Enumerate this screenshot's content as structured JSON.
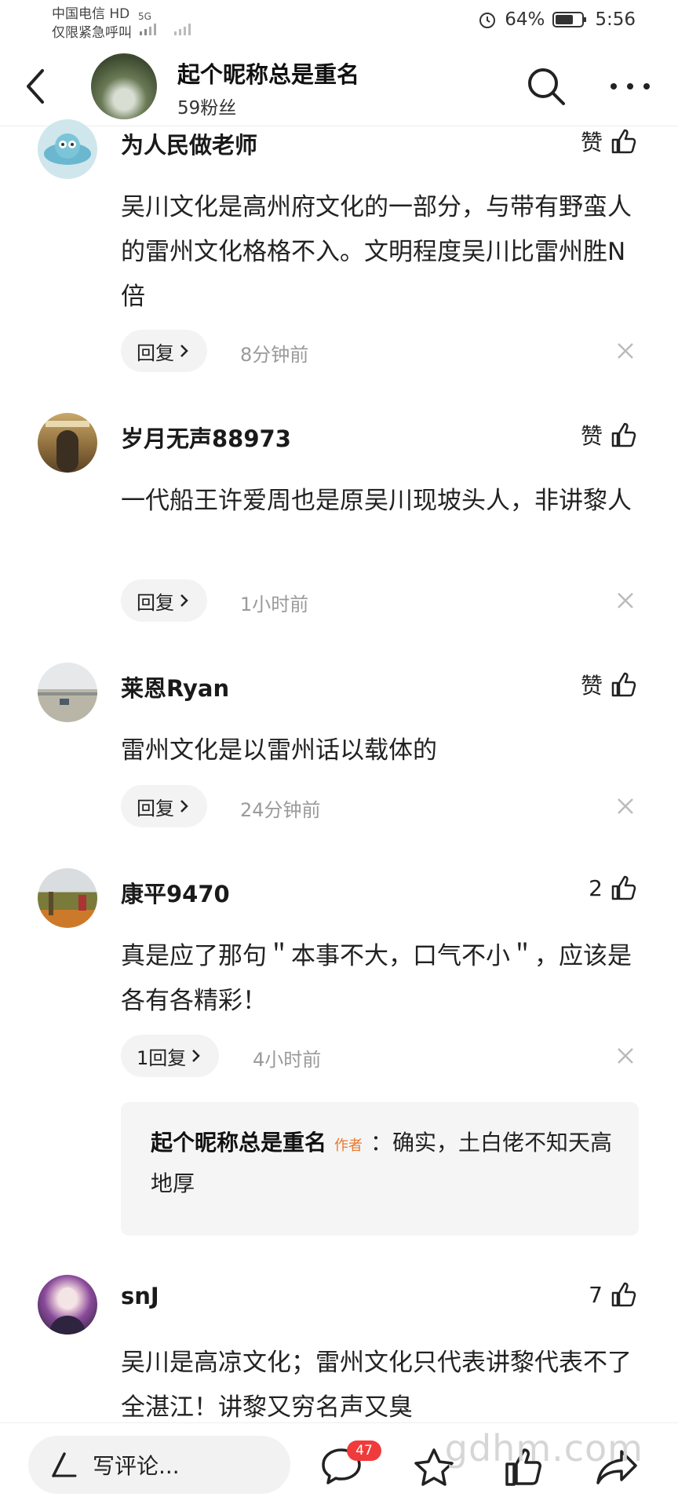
{
  "status_bar": {
    "carrier_line1": "中国电信 HD",
    "carrier_line2": "仅限紧急呼叫",
    "signal": "5G",
    "battery": "64%",
    "time": "5:56"
  },
  "header": {
    "name": "起个昵称总是重名",
    "fans": "59粉丝"
  },
  "comments": [
    {
      "user": "为人民做老师",
      "like": "赞",
      "text": "吴川文化是高州府文化的一部分，与带有野蛮人的雷州文化格格不入。文明程度吴川比雷州胜N倍",
      "reply": "回复",
      "time": "8分钟前"
    },
    {
      "user": "岁月无声88973",
      "like": "赞",
      "text": "一代船王许爱周也是原吴川现坡头人，非讲黎人",
      "reply": "回复",
      "time": "1小时前"
    },
    {
      "user": "莱恩Ryan",
      "like": "赞",
      "text": "雷州文化是以雷州话以载体的",
      "reply": "回复",
      "time": "24分钟前"
    },
    {
      "user": "康平9470",
      "like": "2",
      "text": "真是应了那句＂本事不大，口气不小＂，应该是各有各精彩！",
      "reply": "1回复",
      "time": "4小时前",
      "sub_reply": {
        "author": "起个昵称总是重名",
        "badge": "作者",
        "text": "：确实，土白佬不知天高地厚"
      }
    },
    {
      "user": "snJ",
      "like": "7",
      "text": "吴川是高凉文化；雷州文化只代表讲黎代表不了全湛江！讲黎又穷名声又臭"
    }
  ],
  "bottom_bar": {
    "input_placeholder": "写评论...",
    "comment_count": "47",
    "watermark": "gdhm.com"
  }
}
